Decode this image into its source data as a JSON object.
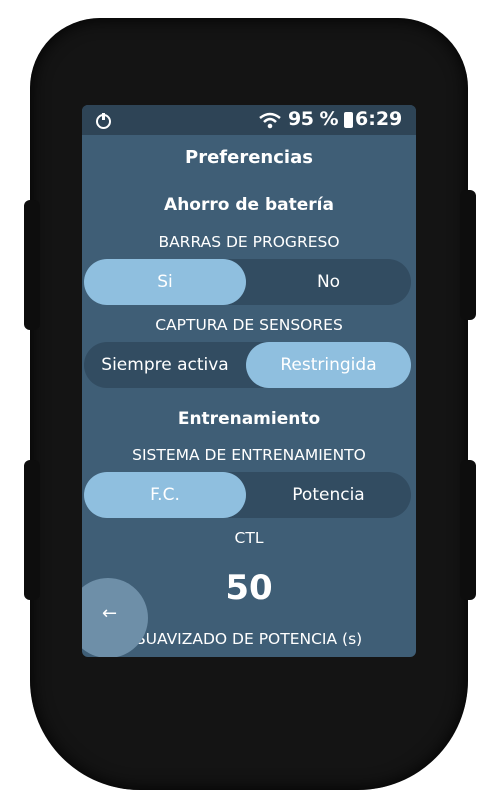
{
  "status": {
    "battery_percent": "95 %",
    "time": "6:29"
  },
  "title": "Preferencias",
  "battery_saving": {
    "section_title": "Ahorro de batería",
    "progress_bars": {
      "label": "BARRAS DE PROGRESO",
      "options": [
        "Si",
        "No"
      ],
      "selected": "Si"
    },
    "sensor_capture": {
      "label": "CAPTURA DE SENSORES",
      "options": [
        "Siempre activa",
        "Restringida"
      ],
      "selected": "Restringida"
    }
  },
  "training": {
    "section_title": "Entrenamiento",
    "training_system": {
      "label": "SISTEMA DE ENTRENAMIENTO",
      "options": [
        "F.C.",
        "Potencia"
      ],
      "selected": "F.C."
    },
    "ctl": {
      "label": "CTL",
      "value": "50"
    },
    "power_smoothing_label": "SUAVIZADO DE POTENCIA (s)"
  },
  "icons": {
    "status_left": "power-icon",
    "wifi": "wifi-icon",
    "battery": "battery-icon",
    "back": "back-arrow-icon"
  }
}
